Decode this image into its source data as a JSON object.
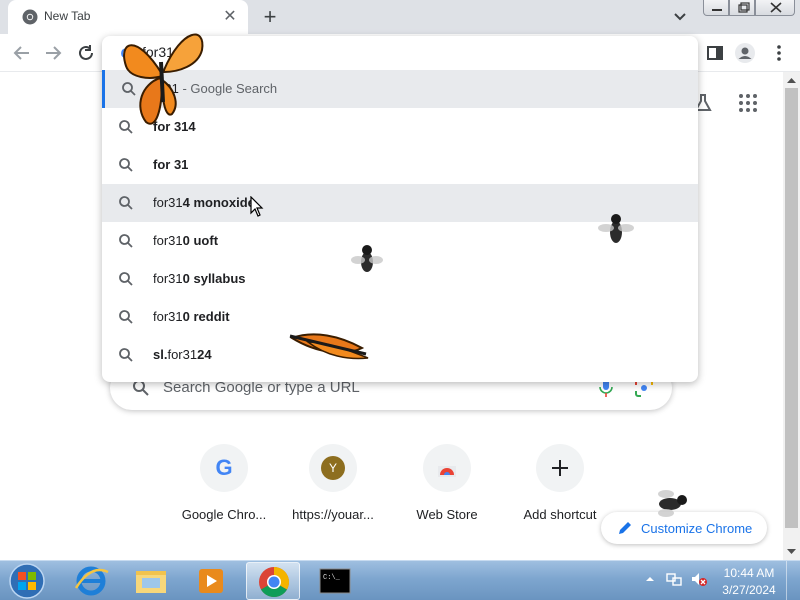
{
  "browser": {
    "tab_title": "New Tab",
    "tab_close_glyph": "✕",
    "new_tab_glyph": "+"
  },
  "omnibox": {
    "input_value": "for31",
    "first_row_rest": "R31",
    "first_row_suffix": " - Google Search",
    "suggestions": [
      {
        "plain": "for",
        "bold": " 314"
      },
      {
        "plain": "for",
        "bold": " 31"
      },
      {
        "plain": "for31",
        "bold": "4 monoxide"
      },
      {
        "plain": "for31",
        "bold": "0 uoft"
      },
      {
        "plain": "for31",
        "bold": "0 syllabus"
      },
      {
        "plain": "for31",
        "bold": "0 reddit"
      },
      {
        "bold_prefix": "sl.",
        "plain": "for31",
        "bold": "24"
      }
    ]
  },
  "ntp": {
    "search_placeholder": "Search Google or type a URL",
    "shortcuts": [
      {
        "label": "Google Chro...",
        "icon": "google-g-icon"
      },
      {
        "label": "https://youar...",
        "icon": "letter-y-avatar",
        "avatar_letter": "Y",
        "avatar_color": "#8d6e1f"
      },
      {
        "label": "Web Store",
        "icon": "webstore-icon"
      },
      {
        "label": "Add shortcut",
        "icon": "plus-icon",
        "glyph": "+"
      }
    ],
    "customize_label": "Customize Chrome"
  },
  "taskbar": {
    "time": "10:44 AM",
    "date": "3/27/2024",
    "cmd_icon_text": "C:\\_"
  },
  "colors": {
    "accent": "#1a73e8",
    "selection_bg": "#e8eaed",
    "tab_strip": "#dee1e6",
    "butterfly": "#f28a1e",
    "fly": "#2b2b2b"
  }
}
